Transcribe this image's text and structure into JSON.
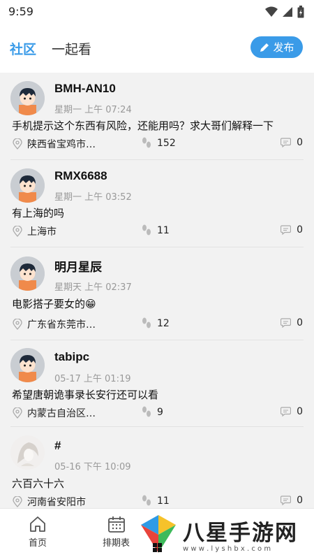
{
  "status": {
    "time": "9:59"
  },
  "header": {
    "tab_community": "社区",
    "tab_watch": "一起看",
    "publish_label": "发布"
  },
  "posts": [
    {
      "username": "BMH-AN10",
      "time": "星期一 上午 07:24",
      "content": "手机提示这个东西有风险，还能用吗？求大哥们解释一下",
      "location": "陕西省宝鸡市…",
      "views": "152",
      "comments": "0"
    },
    {
      "username": "RMX6688",
      "time": "星期一 上午 03:52",
      "content": "有上海的吗",
      "location": "上海市",
      "views": "11",
      "comments": "0"
    },
    {
      "username": "明月星辰",
      "time": "星期天 上午 02:37",
      "content": "电影搭子要女的😁",
      "location": "广东省东莞市…",
      "views": "12",
      "comments": "0"
    },
    {
      "username": "tabipc",
      "time": "05-17 上午 01:19",
      "content": "希望唐朝诡事录长安行还可以看",
      "location": "内蒙古自治区…",
      "views": "9",
      "comments": "0"
    },
    {
      "username": "#",
      "time": "05-16 下午 10:09",
      "content": "六百六十六",
      "location": "河南省安阳市",
      "views": "11",
      "comments": "0"
    }
  ],
  "nav": {
    "home": "首页",
    "schedule": "排期表"
  },
  "watermark": {
    "title": "八星手游网",
    "url": "w w w . l y s h b x . c o m"
  }
}
